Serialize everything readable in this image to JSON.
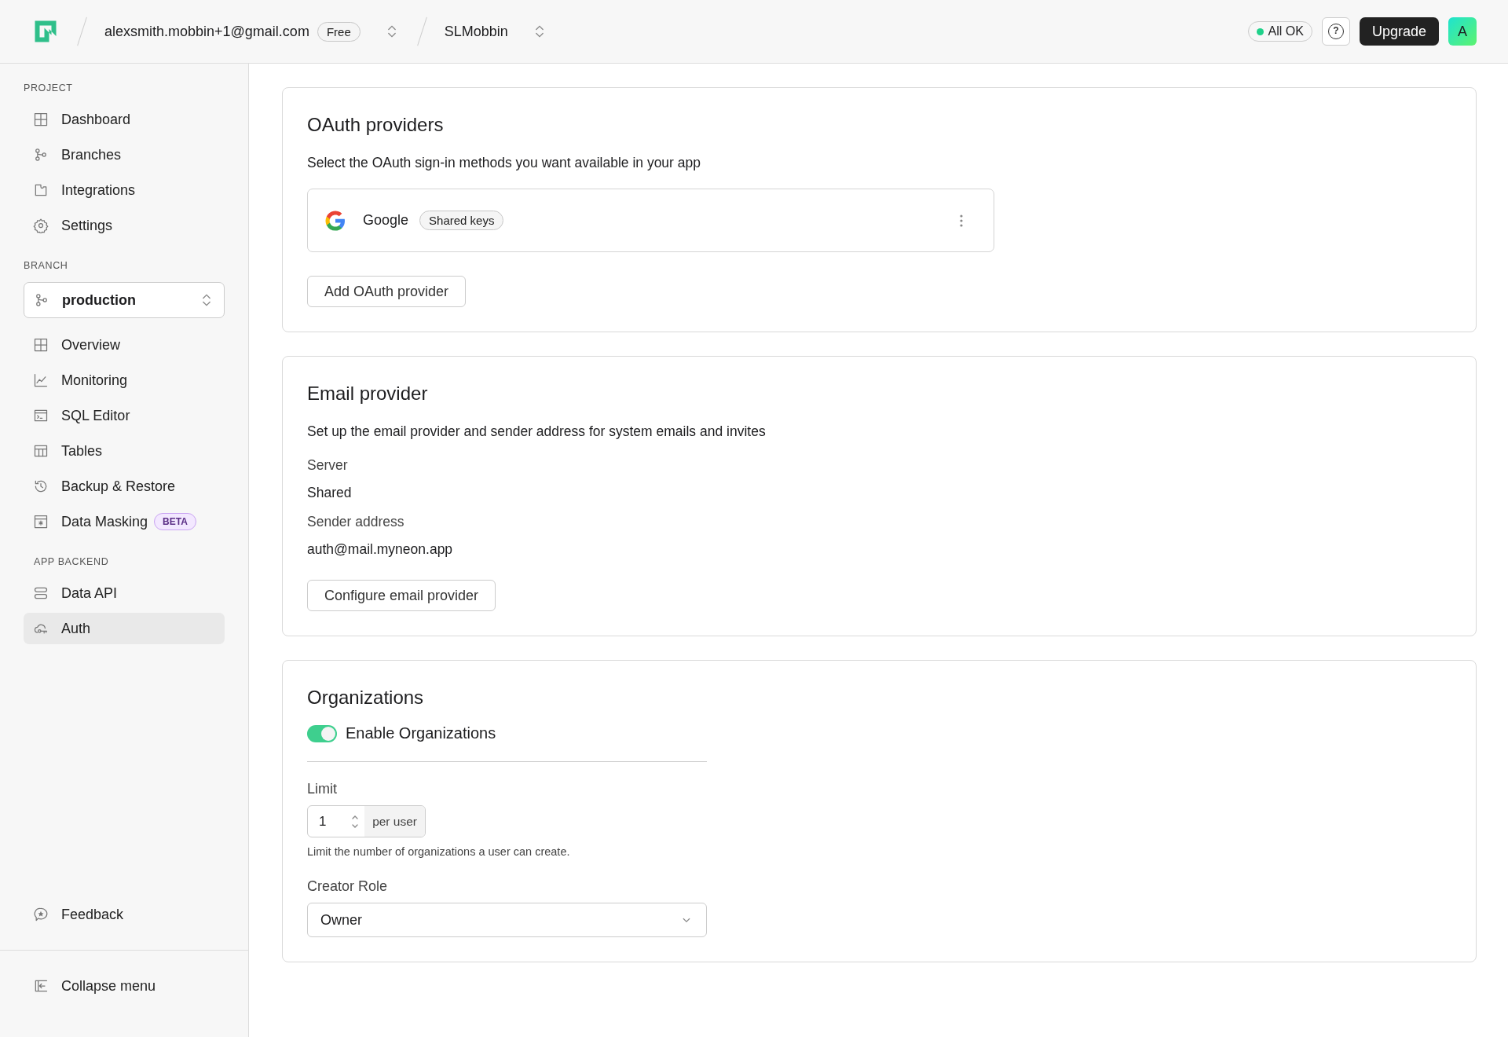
{
  "header": {
    "account": {
      "email": "alexsmith.mobbin+1@gmail.com",
      "plan": "Free"
    },
    "project": {
      "name": "SLMobbin"
    },
    "status": {
      "label": "All OK",
      "color": "#1fd18a"
    },
    "help": {
      "label": "?"
    },
    "upgrade": {
      "label": "Upgrade"
    },
    "avatar": {
      "letter": "A"
    }
  },
  "sidebar": {
    "sections": [
      {
        "heading": "PROJECT",
        "items": [
          {
            "label": "Dashboard",
            "selected": false
          },
          {
            "label": "Branches",
            "selected": false
          },
          {
            "label": "Integrations",
            "selected": false
          },
          {
            "label": "Settings",
            "selected": false
          }
        ]
      },
      {
        "heading": "BRANCH",
        "branch_select": {
          "value": "production"
        },
        "items": [
          {
            "label": "Overview",
            "selected": false
          },
          {
            "label": "Monitoring",
            "selected": false
          },
          {
            "label": "SQL Editor",
            "selected": false
          },
          {
            "label": "Tables",
            "selected": false
          },
          {
            "label": "Backup & Restore",
            "selected": false
          },
          {
            "label": "Data Masking",
            "selected": false,
            "badge": "BETA"
          }
        ]
      },
      {
        "heading": "APP BACKEND",
        "items": [
          {
            "label": "Data API",
            "selected": false
          },
          {
            "label": "Auth",
            "selected": true
          }
        ]
      }
    ],
    "footer_items": [
      {
        "label": "Feedback"
      }
    ],
    "collapse": {
      "label": "Collapse menu"
    }
  },
  "main": {
    "oauth": {
      "title": "OAuth providers",
      "description": "Select the OAuth sign-in methods you want available in your app",
      "providers": [
        {
          "name": "Google",
          "badge": "Shared keys"
        }
      ],
      "add_button": "Add OAuth provider"
    },
    "email": {
      "title": "Email provider",
      "description": "Set up the email provider and sender address for system emails and invites",
      "fields": [
        {
          "label": "Server",
          "value": "Shared"
        },
        {
          "label": "Sender address",
          "value": "auth@mail.myneon.app"
        }
      ],
      "button": "Configure email provider"
    },
    "organizations": {
      "title": "Organizations",
      "toggle": {
        "label": "Enable Organizations",
        "on": true
      },
      "limit": {
        "label": "Limit",
        "value": "1",
        "unit": "per user",
        "help": "Limit the number of organizations a user can create."
      },
      "creator_role": {
        "label": "Creator Role",
        "value": "Owner"
      }
    }
  }
}
